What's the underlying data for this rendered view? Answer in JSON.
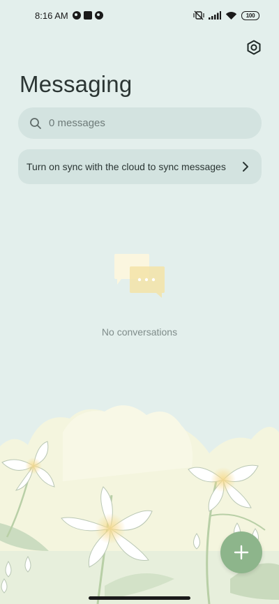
{
  "status_bar": {
    "time": "8:16 AM",
    "battery": "100"
  },
  "header": {
    "title": "Messaging",
    "settings_icon": "settings-hexagon-icon"
  },
  "search": {
    "placeholder": "0 messages",
    "icon": "search-icon"
  },
  "sync_banner": {
    "text": "Turn on sync with the cloud to sync messages",
    "icon": "chevron-right-icon"
  },
  "empty_state": {
    "label": "No conversations",
    "icon": "chat-bubbles-icon"
  },
  "fab": {
    "icon": "plus-icon"
  },
  "colors": {
    "background": "#e3efec",
    "card": "#d3e3e0",
    "fab": "#8db58b"
  }
}
